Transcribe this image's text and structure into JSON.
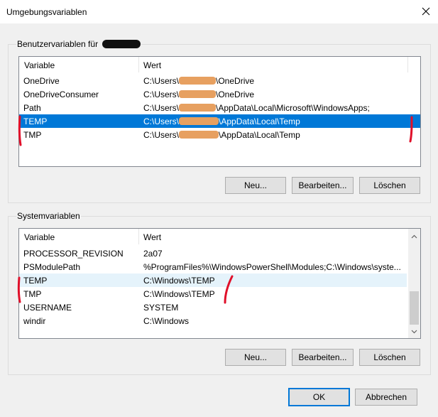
{
  "window": {
    "title": "Umgebungsvariablen",
    "close_label": "✕"
  },
  "user_vars": {
    "label": "Benutzervariablen für",
    "columns": [
      "Variable",
      "Wert"
    ],
    "rows": [
      {
        "name": "OneDrive",
        "pre": "C:\\Users\\",
        "post": "\\OneDrive"
      },
      {
        "name": "OneDriveConsumer",
        "pre": "C:\\Users\\",
        "post": "\\OneDrive"
      },
      {
        "name": "Path",
        "pre": "C:\\Users\\",
        "post": "\\AppData\\Local\\Microsoft\\WindowsApps;"
      },
      {
        "name": "TEMP",
        "pre": "C:\\Users\\",
        "post": "\\AppData\\Local\\Temp",
        "selected": true
      },
      {
        "name": "TMP",
        "pre": "C:\\Users\\",
        "post": "\\AppData\\Local\\Temp"
      }
    ],
    "buttons": {
      "new": "Neu...",
      "edit": "Bearbeiten...",
      "delete": "Löschen"
    }
  },
  "sys_vars": {
    "label": "Systemvariablen",
    "columns": [
      "Variable",
      "Wert"
    ],
    "rows": [
      {
        "name": "PROCESSOR_REVISION",
        "value": "2a07"
      },
      {
        "name": "PSModulePath",
        "value": "%ProgramFiles%\\WindowsPowerShell\\Modules;C:\\Windows\\syste..."
      },
      {
        "name": "TEMP",
        "value": "C:\\Windows\\TEMP",
        "hover": true
      },
      {
        "name": "TMP",
        "value": "C:\\Windows\\TEMP"
      },
      {
        "name": "USERNAME",
        "value": "SYSTEM"
      },
      {
        "name": "windir",
        "value": "C:\\Windows"
      }
    ],
    "buttons": {
      "new": "Neu...",
      "edit": "Bearbeiten...",
      "delete": "Löschen"
    }
  },
  "footer": {
    "ok": "OK",
    "cancel": "Abbrechen"
  },
  "colors": {
    "selection": "#0078d7",
    "hover": "#e5f3fb",
    "annotation_red": "#e0102a",
    "redaction_orange": "#e7a060"
  },
  "icons": {
    "close": "close-icon",
    "scroll_up": "chevron-up-icon",
    "scroll_down": "chevron-down-icon"
  }
}
